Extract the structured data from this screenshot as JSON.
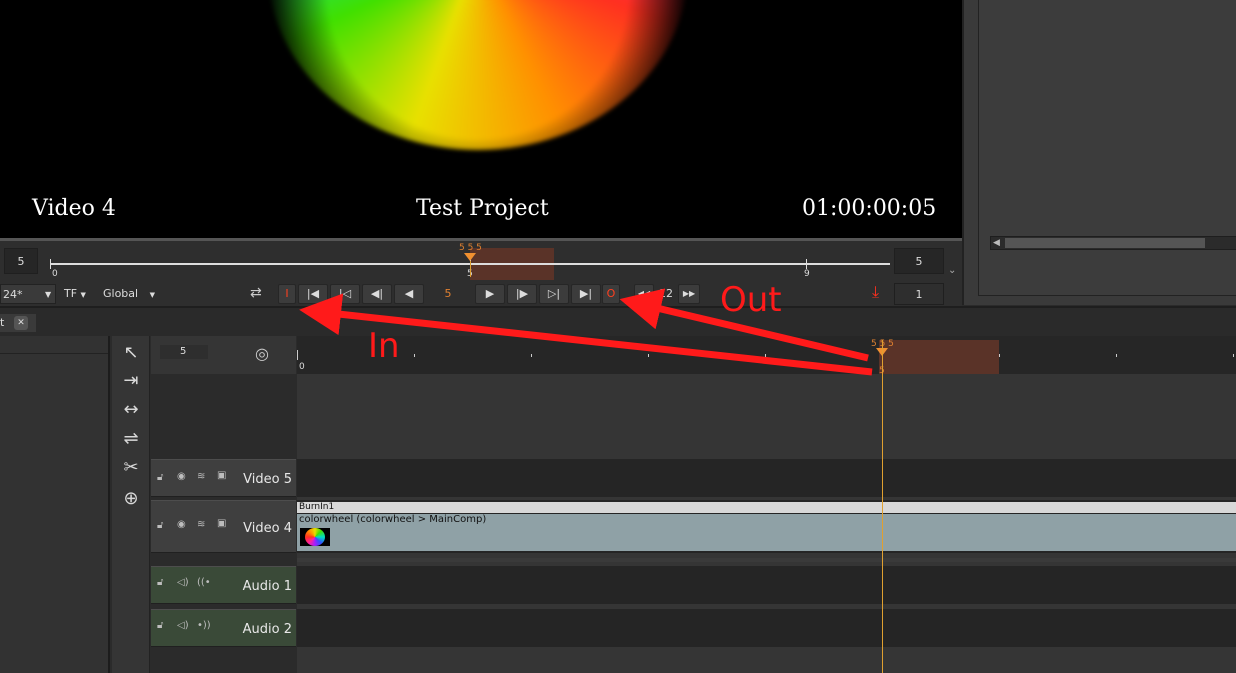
{
  "viewer": {
    "burn_left": "Video 4",
    "burn_center": "Test Project",
    "burn_right": "01:00:00:05"
  },
  "viewer_timeline": {
    "left_frame": "5",
    "right_frame": "5",
    "tick_start": "0",
    "tick_mid": "5",
    "tick_end": "9",
    "playhead_label": "5 5 5"
  },
  "transport": {
    "fps": "24*",
    "tf": "TF",
    "scope": "Global",
    "in_label": "I",
    "out_label": "O",
    "current_frame": "5",
    "step": "12",
    "count": "1"
  },
  "tab": {
    "label": "t"
  },
  "timeline": {
    "frame_field": "5",
    "ruler_start": "0",
    "ruler_playhead": "5",
    "ruler_top_label": "5 5 5",
    "tracks": [
      {
        "name": "Video 5",
        "type": "video"
      },
      {
        "name": "Video 4",
        "type": "video"
      },
      {
        "name": "Audio 1",
        "type": "audio"
      },
      {
        "name": "Audio 2",
        "type": "audio"
      }
    ],
    "clips": {
      "burnin": "BurnIn1",
      "colorwheel": "colorwheel (colorwheel > MainComp)"
    }
  },
  "annotations": {
    "in": "In",
    "out": "Out",
    "color": "#ff1a1a"
  },
  "colors": {
    "range_highlight": "#5a3328",
    "playhead": "#e0a030",
    "clip": "#8fa1a6"
  }
}
